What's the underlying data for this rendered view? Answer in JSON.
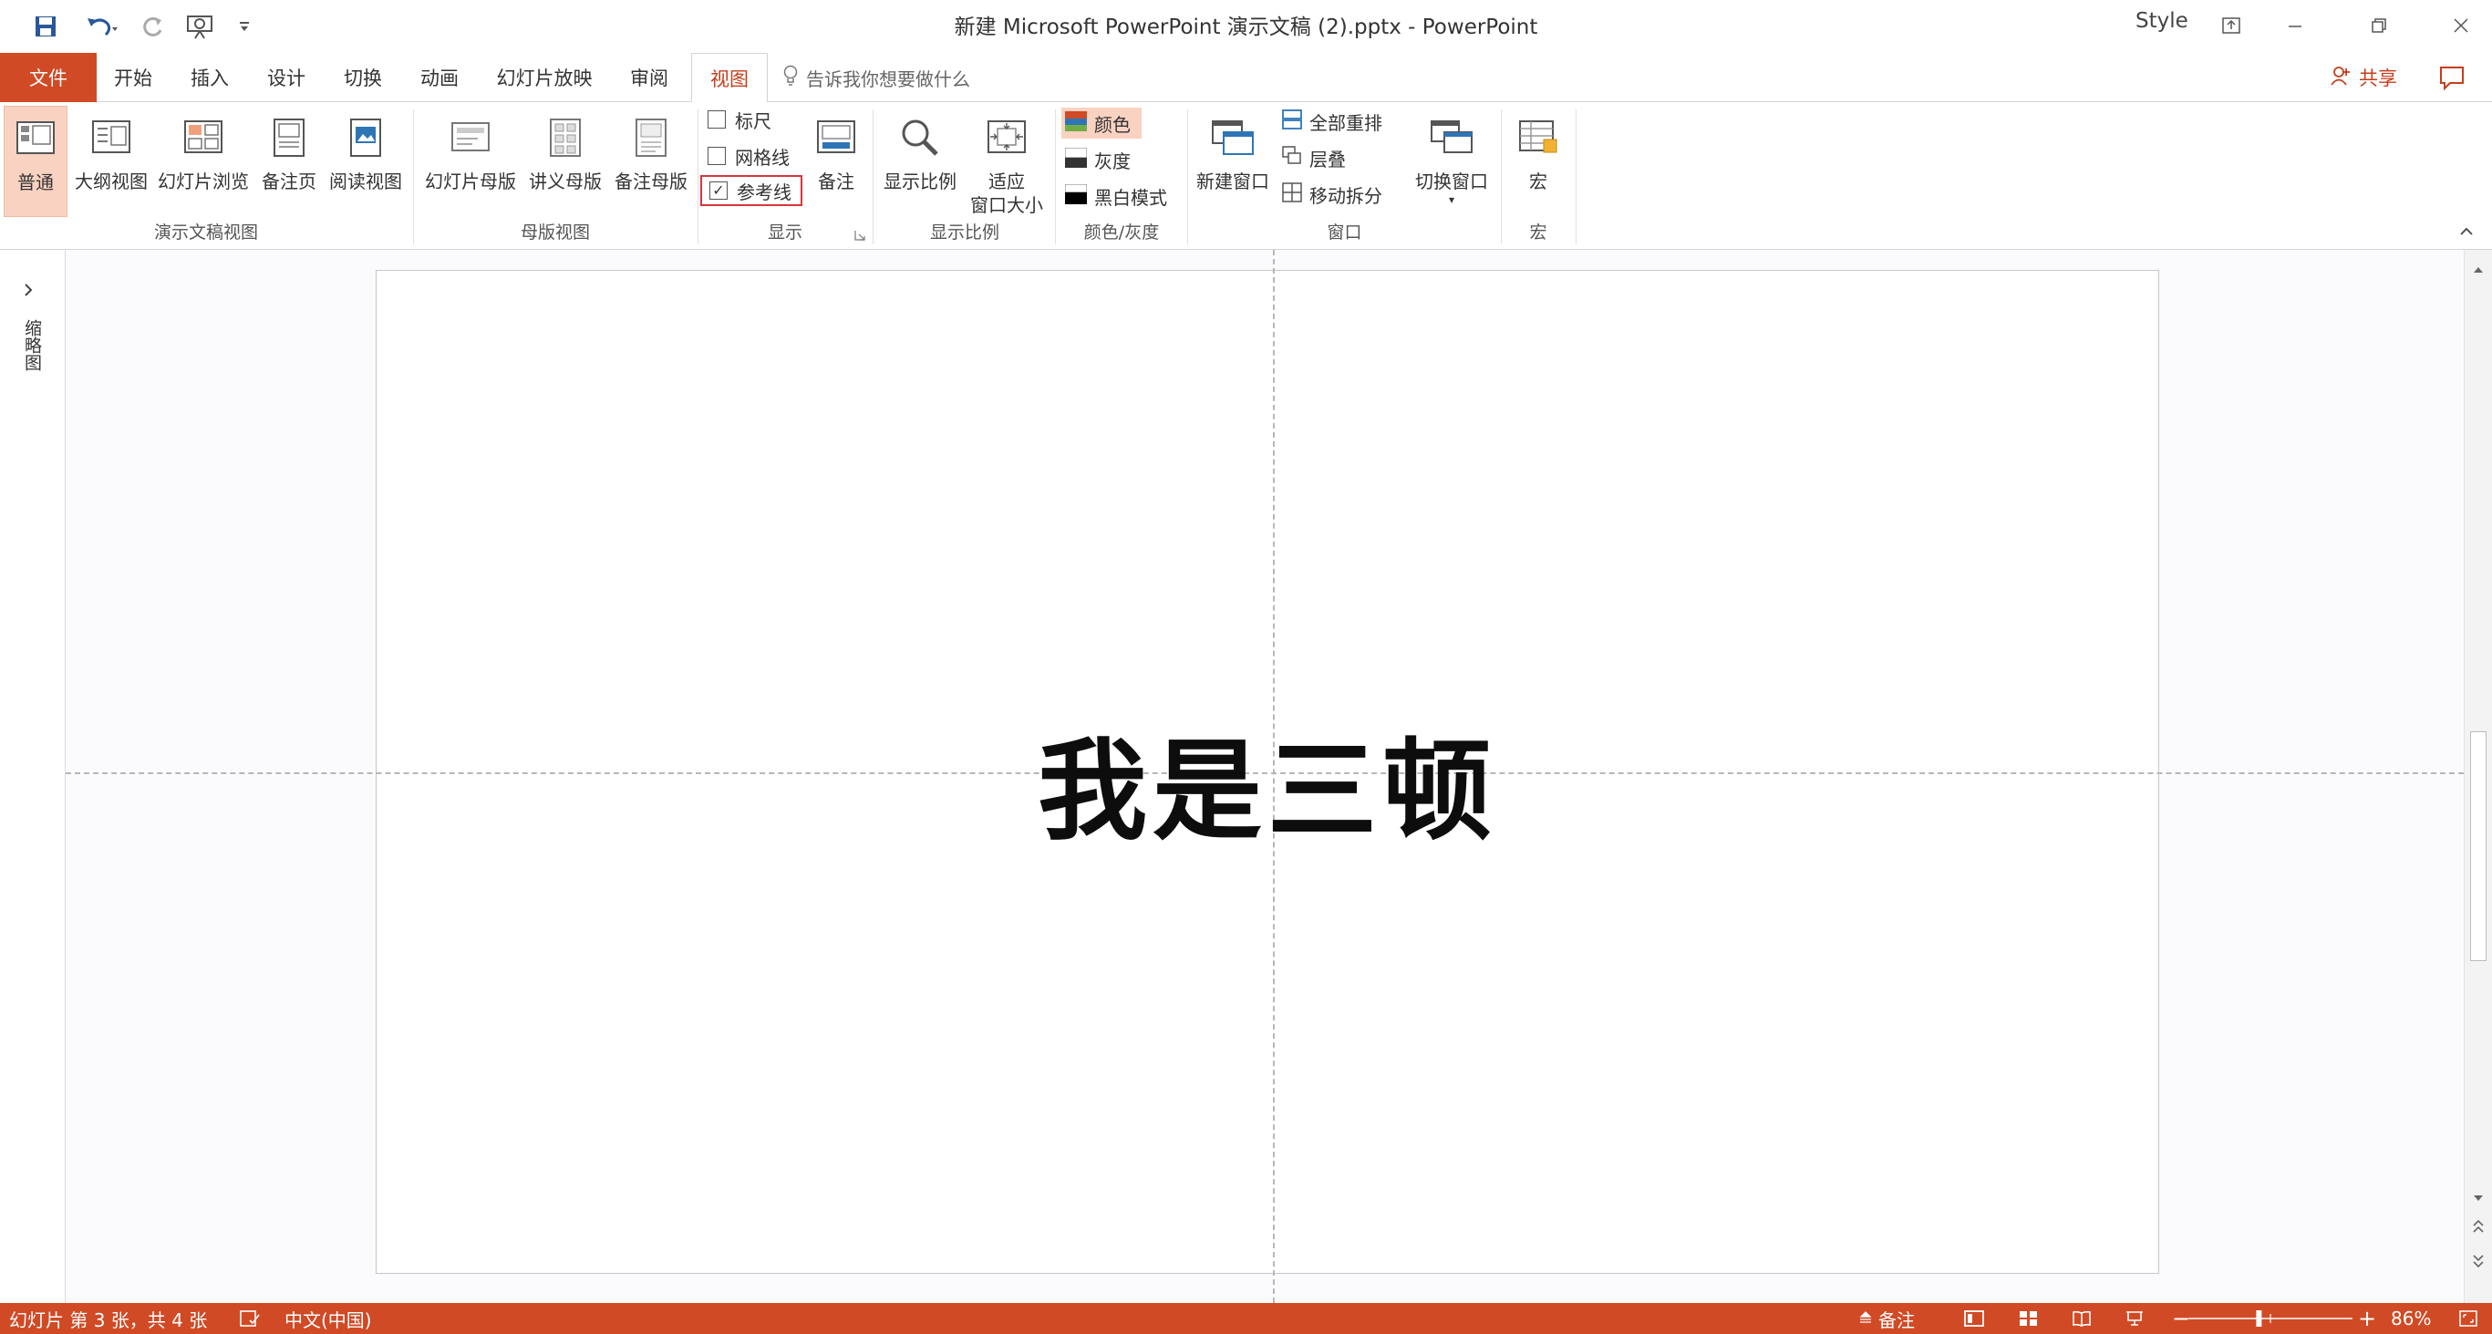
{
  "window": {
    "title": "新建 Microsoft PowerPoint 演示文稿 (2).pptx  -  PowerPoint",
    "style_label": "Style"
  },
  "tabs": {
    "file": "文件",
    "items": [
      "开始",
      "插入",
      "设计",
      "切换",
      "动画",
      "幻灯片放映",
      "审阅",
      "视图"
    ],
    "active": "视图",
    "tellme": "告诉我你想要做什么",
    "share": "共享"
  },
  "ribbon": {
    "presentation_views": {
      "label": "演示文稿视图",
      "buttons": [
        "普通",
        "大纲视图",
        "幻灯片浏览",
        "备注页",
        "阅读视图"
      ]
    },
    "master_views": {
      "label": "母版视图",
      "buttons": [
        "幻灯片母版",
        "讲义母版",
        "备注母版"
      ]
    },
    "show": {
      "label": "显示",
      "ruler": "标尺",
      "gridlines": "网格线",
      "guides": "参考线",
      "notes": "备注"
    },
    "zoom": {
      "label": "显示比例",
      "zoom": "显示比例",
      "fit_line1": "适应",
      "fit_line2": "窗口大小"
    },
    "color": {
      "label": "颜色/灰度",
      "color": "颜色",
      "grayscale": "灰度",
      "bw": "黑白模式"
    },
    "window": {
      "label": "窗口",
      "new_window": "新建窗口",
      "arrange_all": "全部重排",
      "cascade": "层叠",
      "move_split": "移动拆分",
      "switch_window": "切换窗口"
    },
    "macros": {
      "label": "宏",
      "macros": "宏"
    }
  },
  "thumbnails_pane": {
    "label": "缩略图"
  },
  "slide": {
    "text": "我是三顿"
  },
  "status": {
    "slide_info": "幻灯片 第 3 张，共 4 张",
    "language": "中文(中国)",
    "notes": "备注",
    "zoom": "86%",
    "zoom_level_fraction": 0.43
  },
  "colors": {
    "accent": "#d04a25",
    "active_tab_text": "#c43e1c",
    "highlight": "#f9d2c2"
  }
}
